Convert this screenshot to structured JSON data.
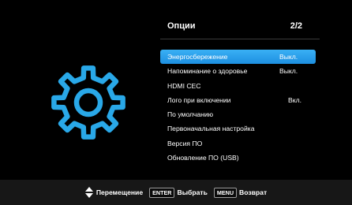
{
  "colors": {
    "accent": "#2a9ff0",
    "gear": "#29a8e8",
    "background": "#000000",
    "footer": "#171717"
  },
  "gear_icon": "gear-icon",
  "header": {
    "title": "Опции",
    "page": "2/2"
  },
  "menu": {
    "items": [
      {
        "label": "Энергосбережение",
        "value": "Выкл.",
        "selected": true
      },
      {
        "label": "Напоминание о здоровье",
        "value": "Выкл."
      },
      {
        "label": "HDMI CEC",
        "value": ""
      },
      {
        "label": "Лого при включении",
        "value": "Вкл."
      },
      {
        "label": "По умолчанию",
        "value": ""
      },
      {
        "label": "Первоначальная настройка",
        "value": ""
      },
      {
        "label": "Версия ПО",
        "value": ""
      },
      {
        "label": "Обновление ПО (USB)",
        "value": ""
      }
    ]
  },
  "footer": {
    "move_label": "Перемещение",
    "enter_key": "ENTER",
    "select_label": "Выбрать",
    "menu_key": "MENU",
    "back_label": "Возврат"
  }
}
